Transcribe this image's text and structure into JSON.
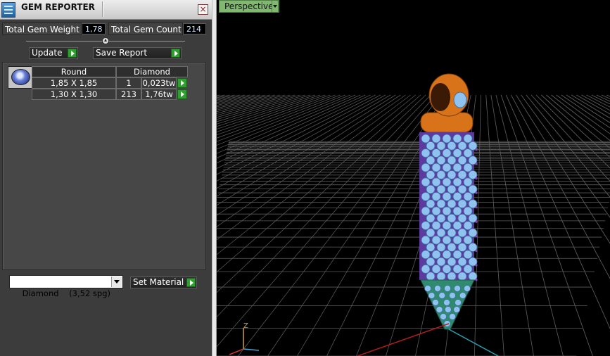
{
  "window": {
    "title": "GEM REPORTER",
    "close_glyph": "×",
    "app_icon": "gem-reporter-icon"
  },
  "summary": {
    "weight_label": "Total Gem Weight",
    "weight_value": "1,78",
    "count_label": "Total Gem Count",
    "count_value": "214"
  },
  "actions": {
    "update_label": "Update",
    "save_report_label": "Save Report"
  },
  "gem_table": {
    "headers": [
      "Round",
      "Diamond"
    ],
    "thumbnail": "round-diamond-icon",
    "rows": [
      {
        "size": "1,85 X 1,85",
        "count": "1",
        "weight": "0,023tw"
      },
      {
        "size": "1,30 X 1,30",
        "count": "213",
        "weight": "1,76tw"
      }
    ]
  },
  "material": {
    "selected": "Diamond    (3,52 spg)",
    "set_label": "Set Material"
  },
  "viewport": {
    "view_name": "Perspective",
    "axis_z_label": "Z"
  },
  "colors": {
    "panel_bg": "#3c3c3c",
    "accent_green": "#2ea02e",
    "view_label_bg": "#7fb86e",
    "bail_orange": "#d9731a",
    "prong_purple": "#8a3fc7",
    "stone_blue": "#8fc2ee",
    "tip_green": "#2f8a6e"
  }
}
